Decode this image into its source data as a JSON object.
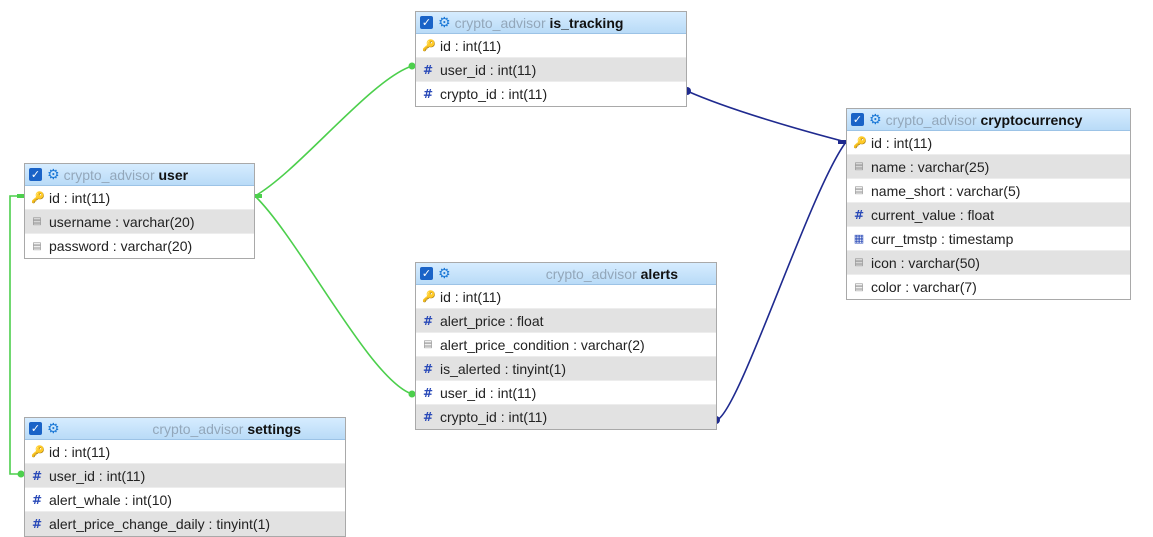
{
  "colors": {
    "user_links": "#4ccf4c",
    "crypto_links": "#1f2a8f",
    "header_gradient_top": "#d6ecff",
    "header_gradient_bottom": "#b9dbf7"
  },
  "tables": {
    "user": {
      "db": "crypto_advisor",
      "name": "user",
      "columns": [
        {
          "label": "id : int(11)",
          "icon": "key-icon"
        },
        {
          "label": "username : varchar(20)",
          "icon": "text-field-icon"
        },
        {
          "label": "password : varchar(20)",
          "icon": "text-field-icon"
        }
      ]
    },
    "settings": {
      "db": "crypto_advisor",
      "name": "settings",
      "columns": [
        {
          "label": "id : int(11)",
          "icon": "key-icon"
        },
        {
          "label": "user_id : int(11)",
          "icon": "numeric-field-icon"
        },
        {
          "label": "alert_whale : int(10)",
          "icon": "numeric-field-icon"
        },
        {
          "label": "alert_price_change_daily : tinyint(1)",
          "icon": "numeric-field-icon"
        }
      ]
    },
    "is_tracking": {
      "db": "crypto_advisor",
      "name": "is_tracking",
      "columns": [
        {
          "label": "id : int(11)",
          "icon": "key-icon"
        },
        {
          "label": "user_id : int(11)",
          "icon": "numeric-field-icon"
        },
        {
          "label": "crypto_id : int(11)",
          "icon": "numeric-field-icon"
        }
      ]
    },
    "alerts": {
      "db": "crypto_advisor",
      "name": "alerts",
      "columns": [
        {
          "label": "id : int(11)",
          "icon": "key-icon"
        },
        {
          "label": "alert_price : float",
          "icon": "numeric-field-icon"
        },
        {
          "label": "alert_price_condition : varchar(2)",
          "icon": "text-field-icon"
        },
        {
          "label": "is_alerted : tinyint(1)",
          "icon": "numeric-field-icon"
        },
        {
          "label": "user_id : int(11)",
          "icon": "numeric-field-icon"
        },
        {
          "label": "crypto_id : int(11)",
          "icon": "numeric-field-icon"
        }
      ]
    },
    "cryptocurrency": {
      "db": "crypto_advisor",
      "name": "cryptocurrency",
      "columns": [
        {
          "label": "id : int(11)",
          "icon": "key-icon"
        },
        {
          "label": "name : varchar(25)",
          "icon": "text-field-icon"
        },
        {
          "label": "name_short : varchar(5)",
          "icon": "text-field-icon"
        },
        {
          "label": "current_value : float",
          "icon": "numeric-field-icon"
        },
        {
          "label": "curr_tmstp : timestamp",
          "icon": "date-field-icon"
        },
        {
          "label": "icon : varchar(50)",
          "icon": "text-field-icon"
        },
        {
          "label": "color : varchar(7)",
          "icon": "text-field-icon"
        }
      ]
    }
  }
}
